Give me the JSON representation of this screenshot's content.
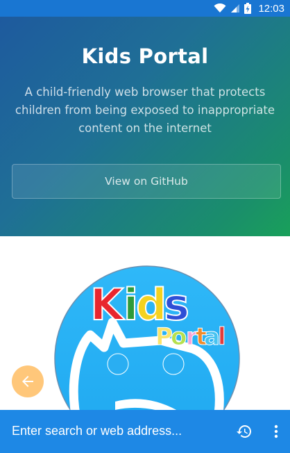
{
  "status_bar": {
    "time": "12:03"
  },
  "hero": {
    "title": "Kids Portal",
    "description": "A child-friendly web browser that protects children from being exposed to inappropriate content on the internet",
    "github_button_label": "View on GitHub"
  },
  "logo": {
    "word1": "Kids",
    "word2": "Portal"
  },
  "address_bar": {
    "placeholder": "Enter search or web address..."
  },
  "colors": {
    "status_bar": "#1976D2",
    "bottom_bar": "#1E88E5",
    "back_fab": "#FFC77A",
    "logo_face": "#29B6F6"
  }
}
